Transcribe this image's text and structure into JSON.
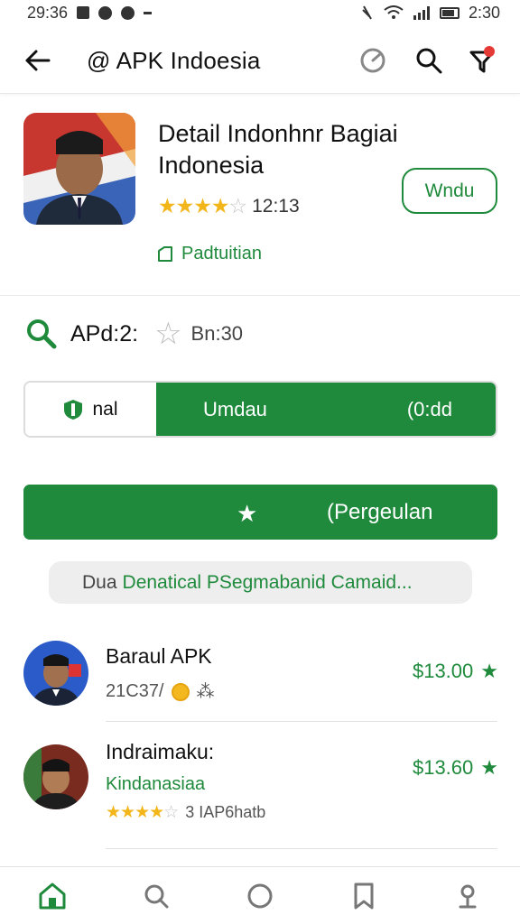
{
  "status_bar": {
    "time_left": "29:36",
    "time_right": "2:30"
  },
  "app_bar": {
    "title": "@ APK Indoesia",
    "icons": [
      "back-icon",
      "refresh-icon",
      "search-icon",
      "filter-icon"
    ],
    "notification_color": "#e53935"
  },
  "hero": {
    "title": "Detail Indonhnr Bagiai Indonesia",
    "rating_stars": 4,
    "rating_max": 5,
    "rating_text": "12:13",
    "install_label": "Wndu",
    "meta_label": "Padtuitian"
  },
  "stats": {
    "label": "APd:2:",
    "value": "Bn:30"
  },
  "segmented": {
    "left_label": "nal",
    "center_label": "Umdau",
    "right_label": "(0:dd"
  },
  "primary_button": {
    "label": "(Pergeulan"
  },
  "chip": {
    "prefix": "Dua",
    "text": "Denatical PSegmabanid Camaid..."
  },
  "list": [
    {
      "name": "Baraul APK",
      "sub": "21C37/",
      "sub_symbol": "⁂",
      "price": "$13.00"
    },
    {
      "name": "Indraimaku:",
      "sub_green": "Kindanasiaa",
      "rating_stars": 4,
      "rating_text": "3 IAP6hatb",
      "price": "$13.60"
    }
  ],
  "bottom_nav": [
    "home-icon",
    "explore-icon",
    "circle-icon",
    "bookmark-icon",
    "profile-icon"
  ],
  "colors": {
    "accent": "#1f8a3c",
    "star": "#f2b61b",
    "chip_bg": "#eeeeee"
  }
}
